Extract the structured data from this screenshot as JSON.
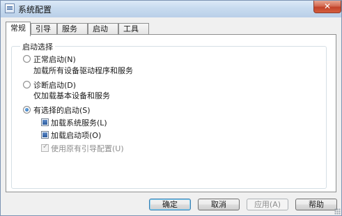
{
  "window": {
    "title": "系统配置",
    "close_glyph": "✕"
  },
  "tabs": [
    {
      "label": "常规"
    },
    {
      "label": "引导"
    },
    {
      "label": "服务"
    },
    {
      "label": "启动"
    },
    {
      "label": "工具"
    }
  ],
  "startup_group": {
    "legend": "启动选择",
    "normal": {
      "label": "正常启动(N)",
      "description": "加载所有设备驱动程序和服务",
      "selected": false
    },
    "diagnostic": {
      "label": "诊断启动(D)",
      "description": "仅加载基本设备和服务",
      "selected": false
    },
    "selective": {
      "label": "有选择的启动(S)",
      "selected": true,
      "options": [
        {
          "label": "加载系统服务(L)",
          "state": "indeterminate",
          "enabled": true
        },
        {
          "label": "加载启动项(O)",
          "state": "indeterminate",
          "enabled": true
        },
        {
          "label": "使用原有引导配置(U)",
          "state": "checked",
          "enabled": false
        }
      ]
    }
  },
  "buttons": {
    "ok": "确定",
    "cancel": "取消",
    "apply": "应用(A)",
    "help": "帮助"
  }
}
